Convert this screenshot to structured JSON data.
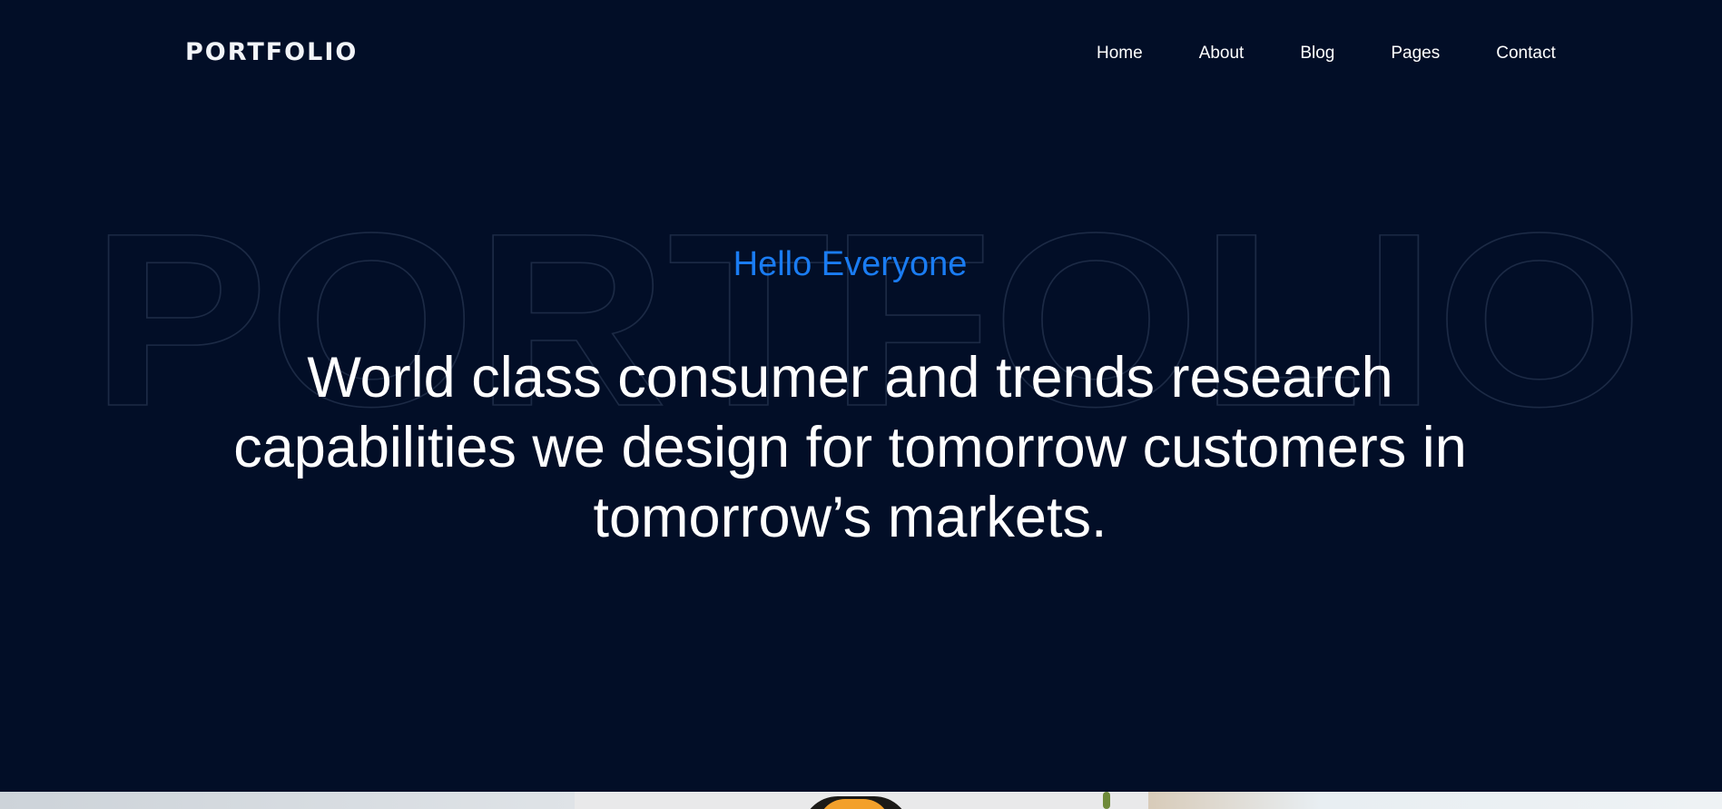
{
  "header": {
    "logo": "PORTFOLIO",
    "nav": [
      "Home",
      "About",
      "Blog",
      "Pages",
      "Contact"
    ]
  },
  "hero": {
    "background_word": "PORTFOLIO",
    "eyebrow": "Hello Everyone",
    "headline": "World class consumer and trends research capabilities we design for tomorrow customers in tomorrow’s markets."
  },
  "colors": {
    "background": "#020e27",
    "accent": "#1a7cf2",
    "text": "#ffffff"
  }
}
